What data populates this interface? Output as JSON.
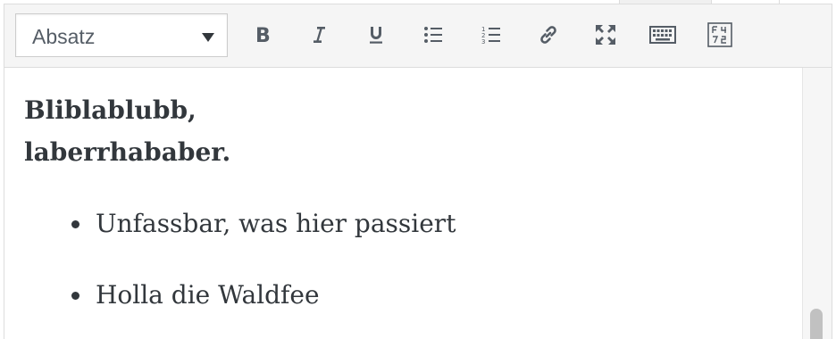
{
  "toolbar": {
    "format_select": {
      "value": "Absatz"
    },
    "buttons": [
      {
        "name": "bold-button",
        "icon": "bold-icon"
      },
      {
        "name": "italic-button",
        "icon": "italic-icon"
      },
      {
        "name": "underline-button",
        "icon": "underline-icon"
      },
      {
        "name": "bullet-list-button",
        "icon": "bullet-list-icon"
      },
      {
        "name": "numbered-list-button",
        "icon": "numbered-list-icon"
      },
      {
        "name": "insert-link-button",
        "icon": "link-icon"
      },
      {
        "name": "fullscreen-button",
        "icon": "fullscreen-icon"
      },
      {
        "name": "toggle-toolbar-button",
        "icon": "keyboard-icon"
      },
      {
        "name": "character-map-button",
        "icon": "character-map-icon"
      }
    ]
  },
  "content": {
    "heading_lines": [
      "Bliblablubb,",
      "laberrhababer."
    ],
    "list_items": [
      "Unfassbar, was hier passiert",
      "Holla die Waldfee"
    ]
  },
  "colors": {
    "toolbar_bg": "#f5f5f5",
    "border": "#dddddd",
    "text": "#32373c",
    "icon": "#555d66"
  }
}
